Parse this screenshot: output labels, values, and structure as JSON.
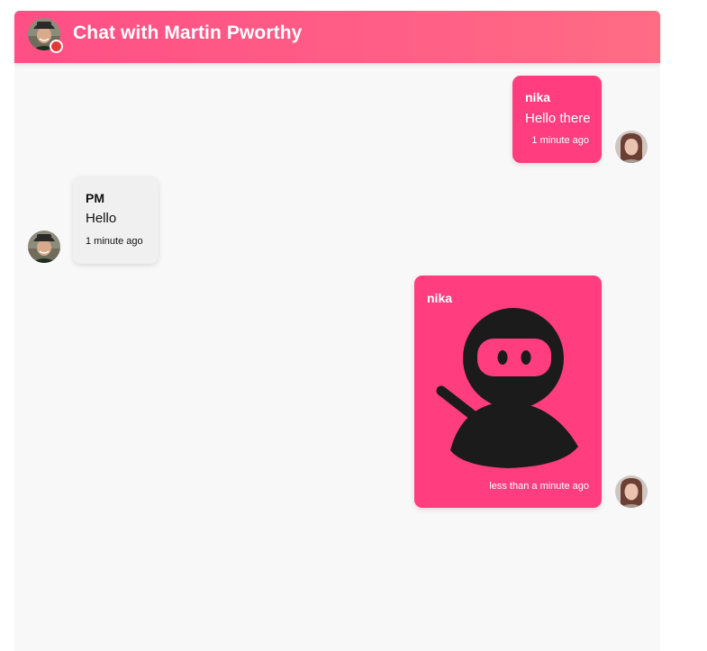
{
  "header": {
    "title": "Chat with Martin Pworthy",
    "avatar_icon": "user-avatar-martin",
    "status_color": "#e53935"
  },
  "colors": {
    "accent": "#ff3d7f",
    "header_gradient_start": "#ff4f86",
    "header_gradient_end": "#ff6c84",
    "received_bubble": "#f0f0f0",
    "chat_background": "#f8f8f8"
  },
  "messages": [
    {
      "sender": "nika",
      "direction": "sent",
      "text": "Hello there",
      "time": "1 minute ago"
    },
    {
      "sender": "PM",
      "direction": "received",
      "text": "Hello",
      "time": "1 minute ago"
    },
    {
      "sender": "nika",
      "direction": "sent",
      "type": "image",
      "image_icon": "ninja-icon",
      "time": "less than a minute ago"
    }
  ]
}
